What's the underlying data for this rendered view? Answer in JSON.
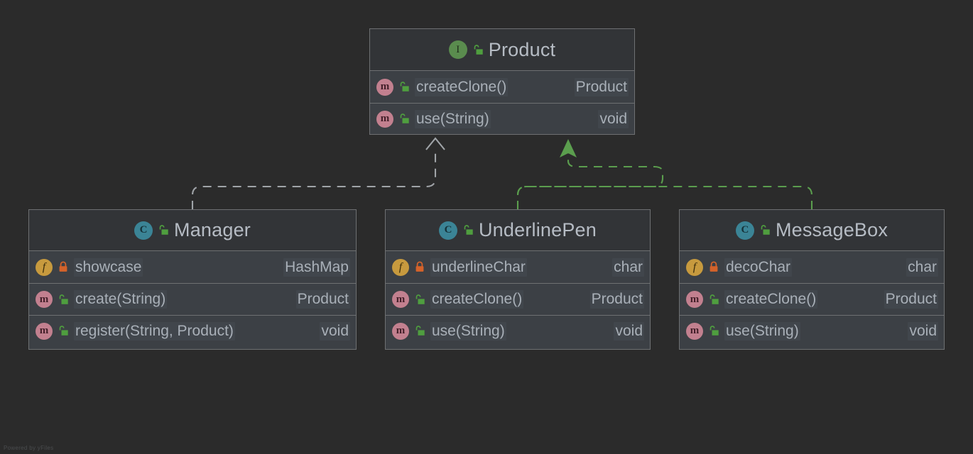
{
  "diagram": {
    "kind": "uml-class-diagram",
    "watermark": "Powered by yFiles",
    "background_color": "#2b2b2b",
    "node_fill": "#3c4045",
    "header_fill": "#323437",
    "border_color": "#6e7072",
    "text_color": "#a9b0b8",
    "title_color": "#b6bcc4",
    "edge_colors": {
      "realization_gray": "#a0a4a8",
      "realization_green": "#5b9e4e"
    },
    "icon_colors": {
      "interface": "#5a8c4e",
      "class": "#3b8496",
      "field": "#c79a3e",
      "method": "#c2808f",
      "lock_public": "#4f9e3f",
      "lock_private": "#d4622a"
    }
  },
  "nodes": [
    {
      "id": "product",
      "name": "Product",
      "stereotype_icon": "interface-icon",
      "stereotype_letter": "I",
      "visibility_icon": "unlocked-padlock-icon",
      "members": [
        {
          "kind_icon": "method-icon",
          "kind_letter": "m",
          "visibility_icon": "unlocked-padlock-icon",
          "name": "createClone()",
          "type": "Product"
        },
        {
          "kind_icon": "method-icon",
          "kind_letter": "m",
          "visibility_icon": "unlocked-padlock-icon",
          "name": "use(String)",
          "type": "void"
        }
      ]
    },
    {
      "id": "manager",
      "name": "Manager",
      "stereotype_icon": "class-icon",
      "stereotype_letter": "C",
      "visibility_icon": "unlocked-padlock-icon",
      "members": [
        {
          "kind_icon": "field-icon",
          "kind_letter": "f",
          "visibility_icon": "locked-padlock-icon",
          "name": "showcase",
          "type": "HashMap"
        },
        {
          "kind_icon": "method-icon",
          "kind_letter": "m",
          "visibility_icon": "unlocked-padlock-icon",
          "name": "create(String)",
          "type": "Product"
        },
        {
          "kind_icon": "method-icon",
          "kind_letter": "m",
          "visibility_icon": "unlocked-padlock-icon",
          "name": "register(String, Product)",
          "type": "void"
        }
      ]
    },
    {
      "id": "underlinepen",
      "name": "UnderlinePen",
      "stereotype_icon": "class-icon",
      "stereotype_letter": "C",
      "visibility_icon": "unlocked-padlock-icon",
      "members": [
        {
          "kind_icon": "field-icon",
          "kind_letter": "f",
          "visibility_icon": "locked-padlock-icon",
          "name": "underlineChar",
          "type": "char"
        },
        {
          "kind_icon": "method-icon",
          "kind_letter": "m",
          "visibility_icon": "unlocked-padlock-icon",
          "name": "createClone()",
          "type": "Product"
        },
        {
          "kind_icon": "method-icon",
          "kind_letter": "m",
          "visibility_icon": "unlocked-padlock-icon",
          "name": "use(String)",
          "type": "void"
        }
      ]
    },
    {
      "id": "messagebox",
      "name": "MessageBox",
      "stereotype_icon": "class-icon",
      "stereotype_letter": "C",
      "visibility_icon": "unlocked-padlock-icon",
      "members": [
        {
          "kind_icon": "field-icon",
          "kind_letter": "f",
          "visibility_icon": "locked-padlock-icon",
          "name": "decoChar",
          "type": "char"
        },
        {
          "kind_icon": "method-icon",
          "kind_letter": "m",
          "visibility_icon": "unlocked-padlock-icon",
          "name": "createClone()",
          "type": "Product"
        },
        {
          "kind_icon": "method-icon",
          "kind_letter": "m",
          "visibility_icon": "unlocked-padlock-icon",
          "name": "use(String)",
          "type": "void"
        }
      ]
    }
  ],
  "edges": [
    {
      "id": "manager-to-product",
      "from": "manager",
      "to": "product",
      "style": "dashed",
      "arrowhead": "open",
      "color": "#a0a4a8"
    },
    {
      "id": "underlinepen-to-product",
      "from": "underlinepen",
      "to": "product",
      "style": "dashed",
      "arrowhead": "solid-triangle",
      "color": "#5b9e4e"
    },
    {
      "id": "messagebox-to-product",
      "from": "messagebox",
      "to": "product",
      "style": "dashed",
      "arrowhead": "solid-triangle",
      "color": "#5b9e4e"
    }
  ]
}
